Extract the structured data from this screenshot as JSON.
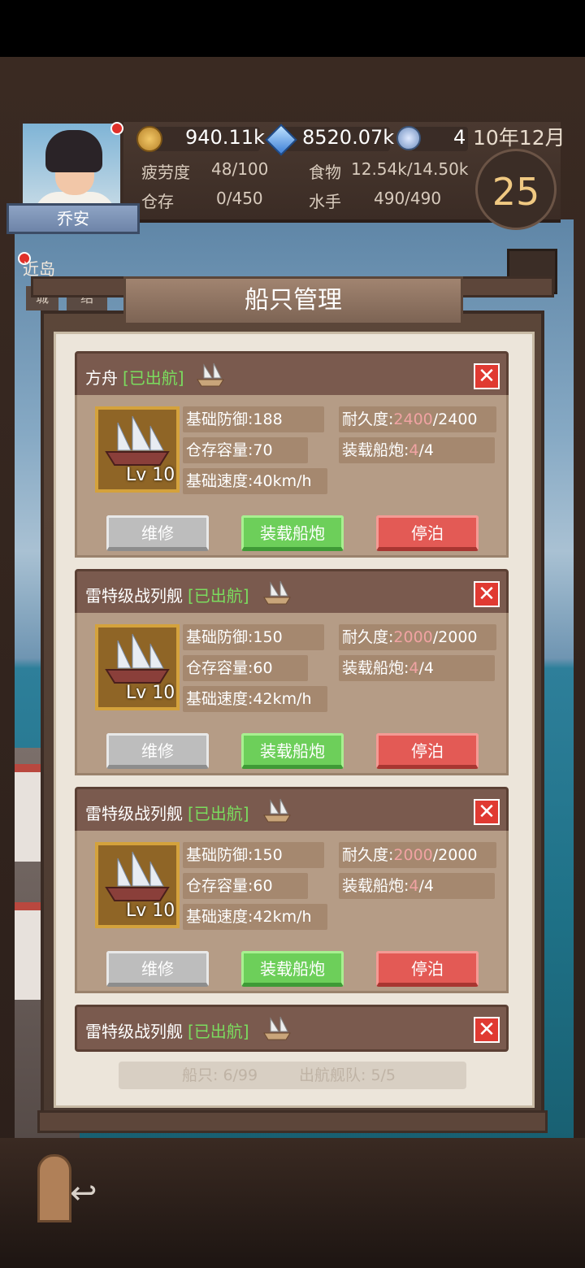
{
  "hud": {
    "player_name": "乔安",
    "gold": "940.11k",
    "gems": "8520.07k",
    "medals": "4",
    "date": "10年12月",
    "day": "25",
    "fatigue_label": "疲劳度",
    "fatigue_value": "48/100",
    "food_label": "食物",
    "food_value": "12.54k/14.50k",
    "storage_label": "仓存",
    "storage_value": "0/450",
    "sailors_label": "水手",
    "sailors_value": "490/490"
  },
  "side": {
    "island_label": "近岛",
    "tag_a": "城",
    "tag_b": "绍"
  },
  "panel": {
    "title": "船只管理",
    "summary_ships": "船只: 6/99",
    "summary_fleet": "出航舰队: 5/5"
  },
  "labels": {
    "defense": "基础防御:",
    "capacity": "仓存容量:",
    "speed": "基础速度:",
    "durability": "耐久度:",
    "cannons": "装载船炮:",
    "repair": "维修",
    "load_cannon": "装载船炮",
    "dock": "停泊",
    "close": "✕"
  },
  "ships": [
    {
      "name": "方舟",
      "status": "[已出航]",
      "level": "Lv 10",
      "defense": "188",
      "capacity": "70",
      "speed": "40km/h",
      "durability_cur": "2400",
      "durability_max": "/2400",
      "cannons_cur": "4",
      "cannons_max": "/4"
    },
    {
      "name": "雷特级战列舰",
      "status": "[已出航]",
      "level": "Lv 10",
      "defense": "150",
      "capacity": "60",
      "speed": "42km/h",
      "durability_cur": "2000",
      "durability_max": "/2000",
      "cannons_cur": "4",
      "cannons_max": "/4"
    },
    {
      "name": "雷特级战列舰",
      "status": "[已出航]",
      "level": "Lv 10",
      "defense": "150",
      "capacity": "60",
      "speed": "42km/h",
      "durability_cur": "2000",
      "durability_max": "/2000",
      "cannons_cur": "4",
      "cannons_max": "/4"
    },
    {
      "name": "雷特级战列舰",
      "status": "[已出航]"
    }
  ],
  "colors": {
    "status_green": "#7bdc5e",
    "highlight_pink": "#f0a3a3",
    "close_red": "#e03a32"
  }
}
